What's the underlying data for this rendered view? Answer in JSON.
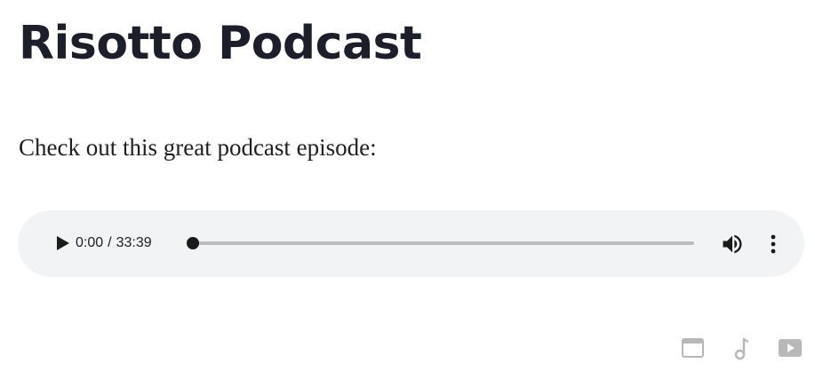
{
  "page": {
    "title": "Risotto Podcast",
    "intro": "Check out this great podcast episode:"
  },
  "player": {
    "current_time": "0:00",
    "separator": "/",
    "duration": "33:39",
    "progress": 0,
    "icons": {
      "play": "play-icon",
      "volume": "volume-icon",
      "menu": "more-vert-icon"
    }
  },
  "extension_icons": [
    {
      "name": "window-icon"
    },
    {
      "name": "music-note-icon"
    },
    {
      "name": "video-icon"
    }
  ],
  "colors": {
    "player_bg": "#f1f3f4",
    "track": "#bdbdbd",
    "control": "#1a1a1a",
    "icon_gray": "#b8b8b8"
  }
}
